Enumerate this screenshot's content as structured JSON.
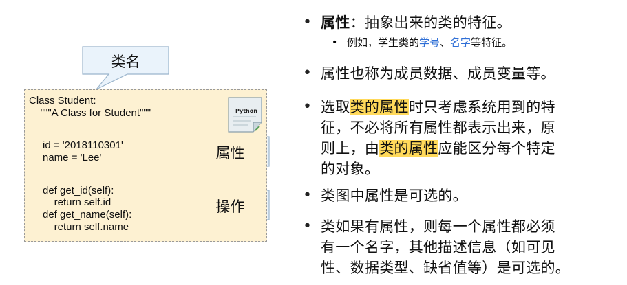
{
  "diagram": {
    "callout_top": "类名",
    "callout_attr": "属性",
    "callout_ops": "操作",
    "icon_label": "Python",
    "code": [
      "Class Student:",
      "    \"\"\"A Class for Student\"\"\"",
      "id = '2018110301'",
      "name = 'Lee'",
      "def get_id(self):",
      "    return self.id",
      "def get_name(self):",
      "    return self.name"
    ]
  },
  "bullets": [
    {
      "term": "属性",
      "colon": "：",
      "rest": "抽象出来的类的特征。"
    },
    {
      "sub": {
        "prefix": "例如，学生类的",
        "b1": "学号",
        "sep": "、",
        "b2": "名字",
        "suffix": "等特征。"
      }
    },
    {
      "text": "属性也称为成员数据、成员变量等。"
    },
    {
      "l1a": "选取",
      "l1hl": "类的属性",
      "l1b": "时只考虑系统用到的特",
      "l2": "征，不必将所有属性都表示出来，原",
      "l3a": "则上，由",
      "l3hl": "类的属性",
      "l3b": "应能区分每个特定",
      "l4": "的对象。"
    },
    {
      "text": "类图中属性是可选的。"
    },
    {
      "l1": "类如果有属性，则每一个属性都必须",
      "l2": "有一个名字，其他描述信息（如可见",
      "l3": "性、数据类型、缺省值等）是可选的。"
    }
  ]
}
